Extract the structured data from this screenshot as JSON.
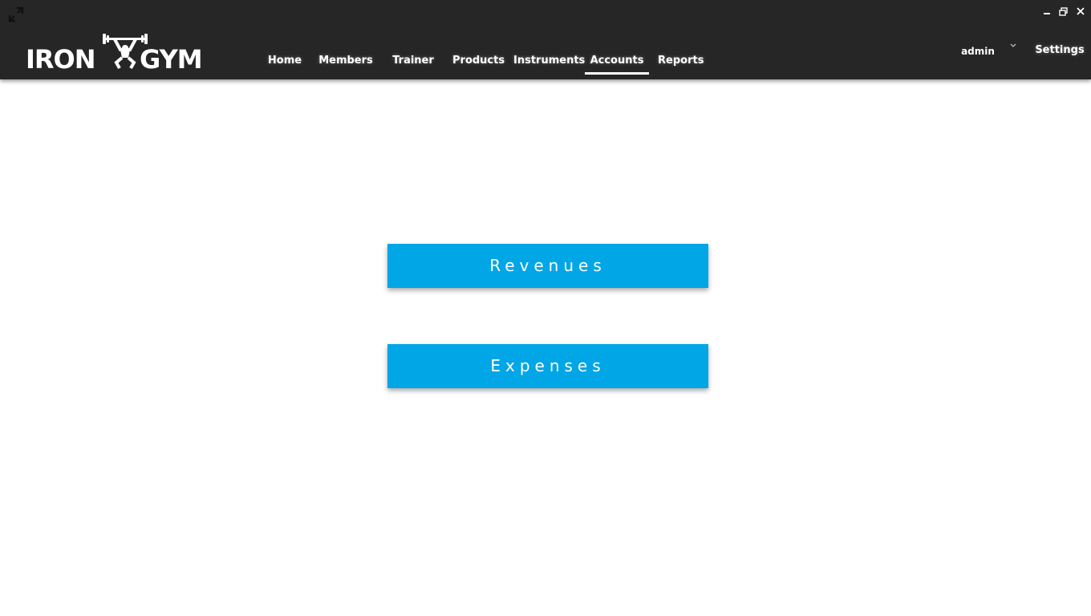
{
  "window": {
    "controls": {
      "minimize_icon": "minimize-icon",
      "restore_icon": "restore-icon",
      "close_icon": "close-icon"
    },
    "expand_icon": "expand-icon"
  },
  "header": {
    "logo_text_left": "IRON",
    "logo_text_right": "GYM",
    "nav": [
      {
        "label": "Home"
      },
      {
        "label": "Members"
      },
      {
        "label": "Trainer"
      },
      {
        "label": "Products"
      },
      {
        "label": "Instruments"
      },
      {
        "label": "Accounts"
      },
      {
        "label": "Reports"
      }
    ],
    "active_nav": "Accounts",
    "user": "admin",
    "settings": "Settings"
  },
  "main": {
    "revenues_label": "Revenues",
    "expenses_label": "Expenses"
  },
  "colors": {
    "topbar": "#262626",
    "button": "#00a6e6",
    "text_light": "#ffffff"
  }
}
